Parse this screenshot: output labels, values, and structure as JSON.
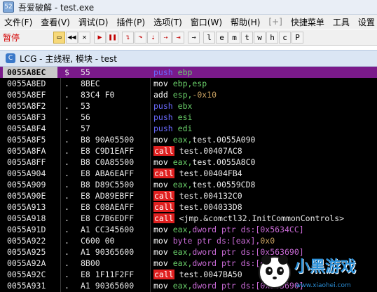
{
  "window": {
    "title": "吾爱破解 - test.exe"
  },
  "menu": [
    "文件(F)",
    "查看(V)",
    "调试(D)",
    "插件(P)",
    "选项(T)",
    "窗口(W)",
    "帮助(H)",
    "[+]",
    "快捷菜单",
    "工具",
    "设置"
  ],
  "toolbar": {
    "status": "暂停",
    "letters": [
      "l",
      "e",
      "m",
      "t",
      "w",
      "h",
      "c",
      "P"
    ]
  },
  "child_window": {
    "title": "LCG - 主线程, 模块 - test"
  },
  "rows": [
    {
      "addr": "0055A8EC",
      "mark": "$",
      "hex": "55",
      "mn": "push",
      "ops": [
        [
          "ebp",
          "reg"
        ]
      ]
    },
    {
      "addr": "0055A8ED",
      "mark": ".",
      "hex": "8BEC",
      "mn": "mov",
      "ops": [
        [
          "ebp,esp",
          "reg"
        ]
      ]
    },
    {
      "addr": "0055A8EF",
      "mark": ".",
      "hex": "83C4 F0",
      "mn": "add",
      "ops": [
        [
          "esp,",
          "reg"
        ],
        [
          "-0x10",
          "neg"
        ]
      ]
    },
    {
      "addr": "0055A8F2",
      "mark": ".",
      "hex": "53",
      "mn": "push",
      "ops": [
        [
          "ebx",
          "reg"
        ]
      ]
    },
    {
      "addr": "0055A8F3",
      "mark": ".",
      "hex": "56",
      "mn": "push",
      "ops": [
        [
          "esi",
          "reg"
        ]
      ]
    },
    {
      "addr": "0055A8F4",
      "mark": ".",
      "hex": "57",
      "mn": "push",
      "ops": [
        [
          "edi",
          "reg"
        ]
      ]
    },
    {
      "addr": "0055A8F5",
      "mark": ".",
      "hex": "B8 90A05500",
      "mn": "mov",
      "ops": [
        [
          "eax,",
          "reg"
        ],
        [
          "test.0055A090",
          "plain"
        ]
      ]
    },
    {
      "addr": "0055A8FA",
      "mark": ".",
      "hex": "E8 C9D1EAFF",
      "mn": "call",
      "ops": [
        [
          "test.00407AC8",
          "plain"
        ]
      ]
    },
    {
      "addr": "0055A8FF",
      "mark": ".",
      "hex": "B8 C0A85500",
      "mn": "mov",
      "ops": [
        [
          "eax,",
          "reg"
        ],
        [
          "test.0055A8C0",
          "plain"
        ]
      ]
    },
    {
      "addr": "0055A904",
      "mark": ".",
      "hex": "E8 ABA6EAFF",
      "mn": "call",
      "ops": [
        [
          "test.00404FB4",
          "plain"
        ]
      ]
    },
    {
      "addr": "0055A909",
      "mark": ".",
      "hex": "B8 D89C5500",
      "mn": "mov",
      "ops": [
        [
          "eax,",
          "reg"
        ],
        [
          "test.00559CD8",
          "plain"
        ]
      ]
    },
    {
      "addr": "0055A90E",
      "mark": ".",
      "hex": "E8 AD89EBFF",
      "mn": "call",
      "ops": [
        [
          "test.004132C0",
          "plain"
        ]
      ]
    },
    {
      "addr": "0055A913",
      "mark": ".",
      "hex": "E8 C08AEAFF",
      "mn": "call",
      "ops": [
        [
          "test.004033D8",
          "plain"
        ]
      ]
    },
    {
      "addr": "0055A918",
      "mark": ".",
      "hex": "E8 C7B6EDFF",
      "mn": "call",
      "ops": [
        [
          "<jmp.&comctl32.InitCommonControls>",
          "plain"
        ]
      ]
    },
    {
      "addr": "0055A91D",
      "mark": ".",
      "hex": "A1 CC345600",
      "mn": "mov",
      "ops": [
        [
          "eax,",
          "reg"
        ],
        [
          "dword ptr ds:[0x5634CC]",
          "ptr"
        ]
      ]
    },
    {
      "addr": "0055A922",
      "mark": ".",
      "hex": "C600 00",
      "mn": "mov",
      "ops": [
        [
          "byte ptr ds:[eax],",
          "ptr"
        ],
        [
          "0x0",
          "neg"
        ]
      ]
    },
    {
      "addr": "0055A925",
      "mark": ".",
      "hex": "A1 90365600",
      "mn": "mov",
      "ops": [
        [
          "eax,",
          "reg"
        ],
        [
          "dword ptr ds:[0x563690]",
          "ptr"
        ]
      ]
    },
    {
      "addr": "0055A92A",
      "mark": ".",
      "hex": "8B00",
      "mn": "mov",
      "ops": [
        [
          "eax,",
          "reg"
        ],
        [
          "dword ptr ds:[eax]",
          "ptr"
        ]
      ]
    },
    {
      "addr": "0055A92C",
      "mark": ".",
      "hex": "E8 1F11F2FF",
      "mn": "call",
      "ops": [
        [
          "test.0047BA50",
          "plain"
        ]
      ]
    },
    {
      "addr": "0055A931",
      "mark": ".",
      "hex": "A1 90365600",
      "mn": "mov",
      "ops": [
        [
          "eax,",
          "reg"
        ],
        [
          "dword ptr ds:[0x563690]",
          "ptr"
        ]
      ]
    }
  ],
  "watermark": {
    "text": "小黑游戏",
    "url": "www.xiaohei.com"
  }
}
